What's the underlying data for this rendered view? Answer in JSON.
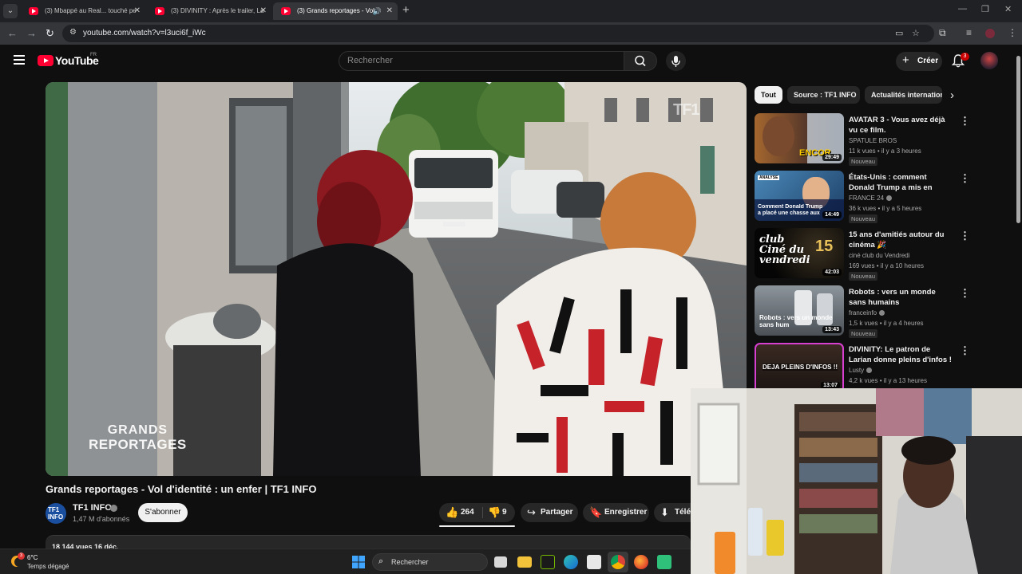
{
  "browser": {
    "tabs": [
      {
        "title": "(3) Mbappé au Real... touché pe",
        "active": false
      },
      {
        "title": "(3) DIVINITY : Après le trailer, La",
        "active": false
      },
      {
        "title": "(3) Grands reportages - Vol",
        "active": true
      }
    ],
    "url": "youtube.com/watch?v=l3uci6f_iWc"
  },
  "header": {
    "logo_text": "YouTube",
    "country": "FR",
    "search_placeholder": "Rechercher",
    "create_label": "Créer",
    "notifications_count": "3"
  },
  "video": {
    "brand_line1": "GRANDS",
    "brand_line2": "REPORTAGES",
    "watermark": "TF1",
    "title": "Grands reportages - Vol d'identité : un enfer | TF1 INFO",
    "channel": "TF1 INFO",
    "channel_avatar_text": "TF1 INFO",
    "subscribers": "1,47 M d'abonnés",
    "subscribe_label": "S'abonner",
    "likes": "264",
    "dislikes": "9",
    "share_label": "Partager",
    "save_label": "Enregistrer",
    "download_label": "Télé",
    "description_preview": "18 144 vues  16 déc."
  },
  "chips": [
    "Tout",
    "Source : TF1 INFO",
    "Actualités internationales"
  ],
  "recommendations": [
    {
      "title": "AVATAR 3 - Vous avez déjà vu ce film.",
      "channel": "SPATULE BROS",
      "verified": false,
      "meta": "11 k vues • il y a 3 heures",
      "badge": "Nouveau",
      "duration": "29:49",
      "thumb_text": "ENCOR"
    },
    {
      "title": "États-Unis : comment Donald Trump a mis en place une ...",
      "channel": "FRANCE 24",
      "verified": true,
      "meta": "36 k vues • il y a 5 heures",
      "badge": "Nouveau",
      "duration": "14:49",
      "thumb_text": "Comment Donald Trump a placé une chasse aux imm",
      "thumb_label": "ANALYSE"
    },
    {
      "title": "15 ans d'amitiés  autour du cinéma 🎉",
      "channel": "ciné club du Vendredi",
      "verified": false,
      "meta": "169 vues • il y a 10 heures",
      "badge": "Nouveau",
      "duration": "42:03",
      "thumb_text": "club Ciné du vendredi",
      "thumb_num": "15"
    },
    {
      "title": "Robots : vers un monde sans humains",
      "channel": "franceinfo",
      "verified": true,
      "meta": "1,5 k vues • il y a 4 heures",
      "badge": "Nouveau",
      "duration": "13:43",
      "thumb_text": "Robots : vers un monde sans hum"
    },
    {
      "title": "DIVINITY: Le patron de Larian donne pleins d'infos !",
      "channel": "Lusty",
      "verified": true,
      "meta": "4,2 k vues • il y a 13 heures",
      "badge": "",
      "duration": "13:07",
      "thumb_text": "DEJA PLEINS D'INFOS !!"
    }
  ],
  "taskbar": {
    "temperature": "6°C",
    "weather": "Temps dégagé",
    "weather_badge": "3",
    "search_placeholder": "Rechercher"
  },
  "colors": {
    "yt_red": "#ff0033",
    "background": "#0f0f0f",
    "chip": "#272727"
  }
}
